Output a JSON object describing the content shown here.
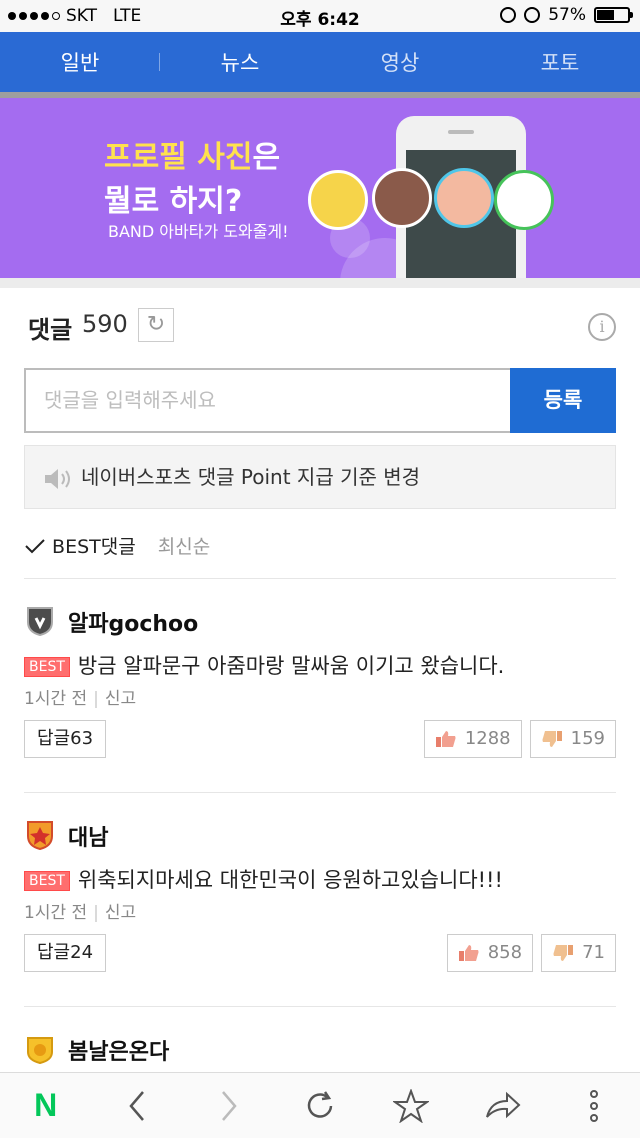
{
  "status_bar": {
    "carrier": "SKT",
    "network": "LTE",
    "time": "오후 6:42",
    "battery_percent": "57%",
    "battery_level": 0.57
  },
  "nav": {
    "tabs": [
      {
        "label": "일반"
      },
      {
        "label": "뉴스"
      },
      {
        "label": "영상"
      },
      {
        "label": "포토"
      }
    ]
  },
  "banner": {
    "line1_highlight": "프로필 사진",
    "line1_rest": "은",
    "line2": "뭘로 하지?",
    "subtitle": "BAND 아바타가 도와줄게!"
  },
  "comments_header": {
    "title": "댓글",
    "count": "590"
  },
  "comment_input": {
    "placeholder": "댓글을 입력해주세요",
    "submit_label": "등록"
  },
  "notice": {
    "text": "네이버스포츠 댓글 Point 지급 기준 변경"
  },
  "sort": {
    "best_label": "BEST댓글",
    "latest_label": "최신순"
  },
  "comments": [
    {
      "user": "알파gochoo",
      "tag": "BEST",
      "text": "방금 알파문구 아줌마랑 말싸움 이기고 왔습니다.",
      "time": "1시간 전",
      "report": "신고",
      "reply_label": "답글63",
      "likes": "1288",
      "dislikes": "159"
    },
    {
      "user": "대남",
      "tag": "BEST",
      "text": "위축되지마세요 대한민국이 응원하고있습니다!!!",
      "time": "1시간 전",
      "report": "신고",
      "reply_label": "답글24",
      "likes": "858",
      "dislikes": "71"
    },
    {
      "user": "봄날은온다"
    }
  ],
  "colors": {
    "nav_bg": "#2a6ad4",
    "banner_bg": "#a46cf0",
    "submit_bg": "#1f6cd3",
    "best_tag": "#ff6e6e",
    "naver_green": "#03c75a"
  },
  "toolbar": {
    "icons": [
      "naver-logo-icon",
      "back-icon",
      "forward-icon",
      "refresh-icon",
      "bookmark-star-icon",
      "share-icon",
      "more-icon"
    ],
    "logo_letter": "N"
  }
}
